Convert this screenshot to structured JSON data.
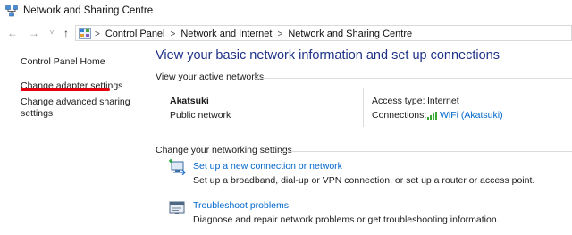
{
  "window": {
    "title": "Network and Sharing Centre"
  },
  "navigation": {
    "back_glyph": "←",
    "forward_glyph": "→",
    "dropdown_glyph": "˅",
    "up_glyph": "↑",
    "breadcrumbs": [
      "Control Panel",
      "Network and Internet",
      "Network and Sharing Centre"
    ],
    "separator": ">"
  },
  "sidebar": {
    "home": "Control Panel Home",
    "adapter": "Change adapter settings",
    "sharing_line1": "Change advanced sharing",
    "sharing_line2": "settings"
  },
  "main": {
    "heading": "View your basic network information and set up connections",
    "active_networks_label": "View your active networks",
    "network": {
      "name": "Akatsuki",
      "category": "Public network",
      "access_type_label": "Access type:",
      "access_type_value": "Internet",
      "connections_label": "Connections:",
      "connection_link": "WiFi (Akatsuki)"
    },
    "change_settings_label": "Change your networking settings",
    "tasks": {
      "new_connection": {
        "link": "Set up a new connection or network",
        "description": "Set up a broadband, dial-up or VPN connection, or set up a router or access point."
      },
      "troubleshoot": {
        "link": "Troubleshoot problems",
        "description": "Diagnose and repair network problems or get troubleshooting information."
      }
    }
  },
  "colors": {
    "heading": "#1e3287",
    "link": "#0066cc",
    "annotation_underline": "#e3000f"
  },
  "icons": {
    "title": "network-sharing-icon",
    "address": "control-panel-icon",
    "wifi": "wifi-signal-icon",
    "new_connection": "new-connection-icon",
    "troubleshoot": "troubleshoot-icon"
  }
}
